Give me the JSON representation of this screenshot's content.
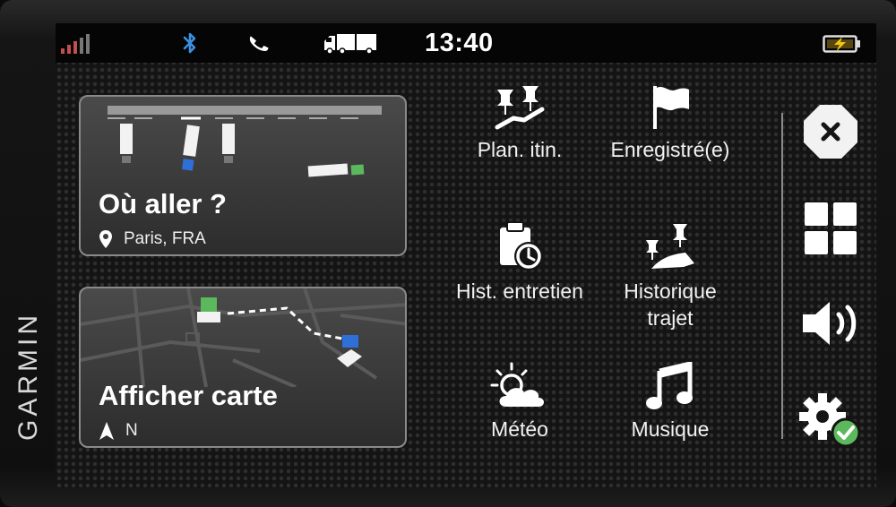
{
  "device": {
    "brand": "GARMIN"
  },
  "status_bar": {
    "time": "13:40",
    "icons": [
      "signal-icon",
      "bluetooth-icon",
      "phone-icon",
      "truck-icon",
      "battery-charging-icon"
    ]
  },
  "cards": {
    "where_to": {
      "title": "Où aller ?",
      "location": "Paris, FRA"
    },
    "view_map": {
      "title": "Afficher carte",
      "heading": "N"
    }
  },
  "menu": {
    "items": [
      {
        "label": "Plan. itin.",
        "icon": "trip-planner-icon"
      },
      {
        "label": "Enregistré(e)",
        "icon": "flag-icon"
      },
      {
        "label": "Hist. entretien",
        "icon": "service-history-icon"
      },
      {
        "label_line1": "Historique",
        "label_line2": "trajet",
        "icon": "trip-history-icon"
      },
      {
        "label": "Météo",
        "icon": "weather-icon"
      },
      {
        "label": "Musique",
        "icon": "music-icon"
      }
    ]
  },
  "sidebar": {
    "buttons": [
      "close-icon",
      "apps-icon",
      "volume-icon",
      "settings-icon"
    ]
  },
  "colors": {
    "accent_green": "#5cb85c",
    "accent_blue": "#2f6fd8",
    "signal_red": "#c0504d",
    "bluetooth_blue": "#3d8fe0",
    "battery_yellow": "#f0c419"
  }
}
